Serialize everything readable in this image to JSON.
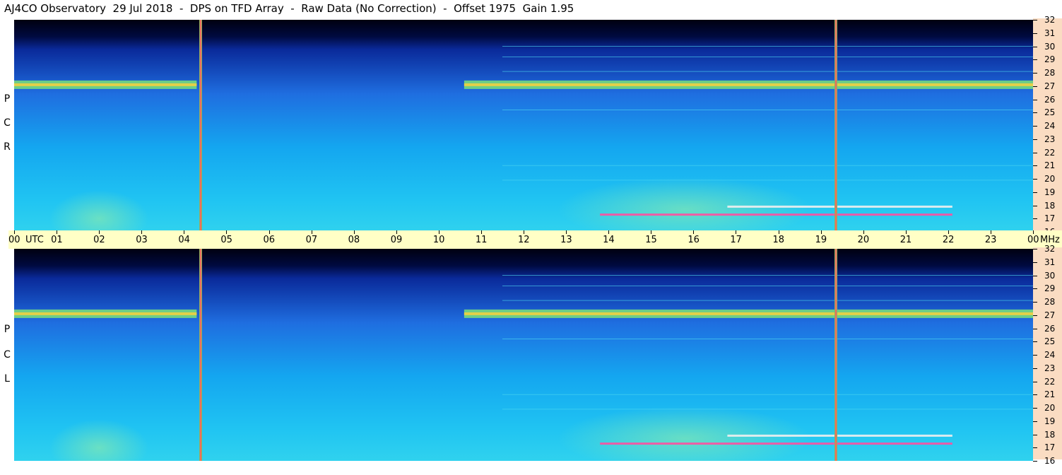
{
  "header": {
    "title": "AJ4CO Observatory  29 Jul 2018  -  DPS on TFD Array  -  Raw Data (No Correction)  -  Offset 1975  Gain 1.95"
  },
  "panels": [
    {
      "id": "rcp",
      "letters": [
        "R",
        "C",
        "P"
      ]
    },
    {
      "id": "lcp",
      "letters": [
        "L",
        "C",
        "P"
      ]
    }
  ],
  "chart_data": {
    "type": "heatmap",
    "title": "AJ4CO Observatory  29 Jul 2018  -  DPS on TFD Array  -  Raw Data (No Correction)  -  Offset 1975  Gain 1.95",
    "x_axis": {
      "unit_label": "UTC",
      "range_hours": [
        0,
        24
      ],
      "tick_labels": [
        "00",
        "01",
        "02",
        "03",
        "04",
        "05",
        "06",
        "07",
        "08",
        "09",
        "10",
        "11",
        "12",
        "13",
        "14",
        "15",
        "16",
        "17",
        "18",
        "19",
        "20",
        "21",
        "22",
        "23",
        "00"
      ]
    },
    "y_axis": {
      "unit_label": "MHz",
      "range_mhz": [
        16,
        32
      ],
      "tick_labels": [
        "32",
        "31",
        "30",
        "29",
        "28",
        "27",
        "26",
        "25",
        "24",
        "23",
        "22",
        "21",
        "20",
        "19",
        "18",
        "17",
        "16"
      ]
    },
    "series": [
      {
        "name": "R C P",
        "polarization": "RCP"
      },
      {
        "name": "L C P",
        "polarization": "LCP"
      }
    ],
    "features": {
      "strong_band_mhz": 27.1,
      "band_active_utc": [
        [
          0.0,
          4.3
        ],
        [
          10.6,
          24.0
        ]
      ],
      "lower_bands_mhz": [
        17.3,
        17.9
      ],
      "lower_band_active_utc": [
        [
          13.8,
          22.1
        ]
      ],
      "vertical_markers_utc": [
        4.4,
        19.35
      ]
    }
  }
}
